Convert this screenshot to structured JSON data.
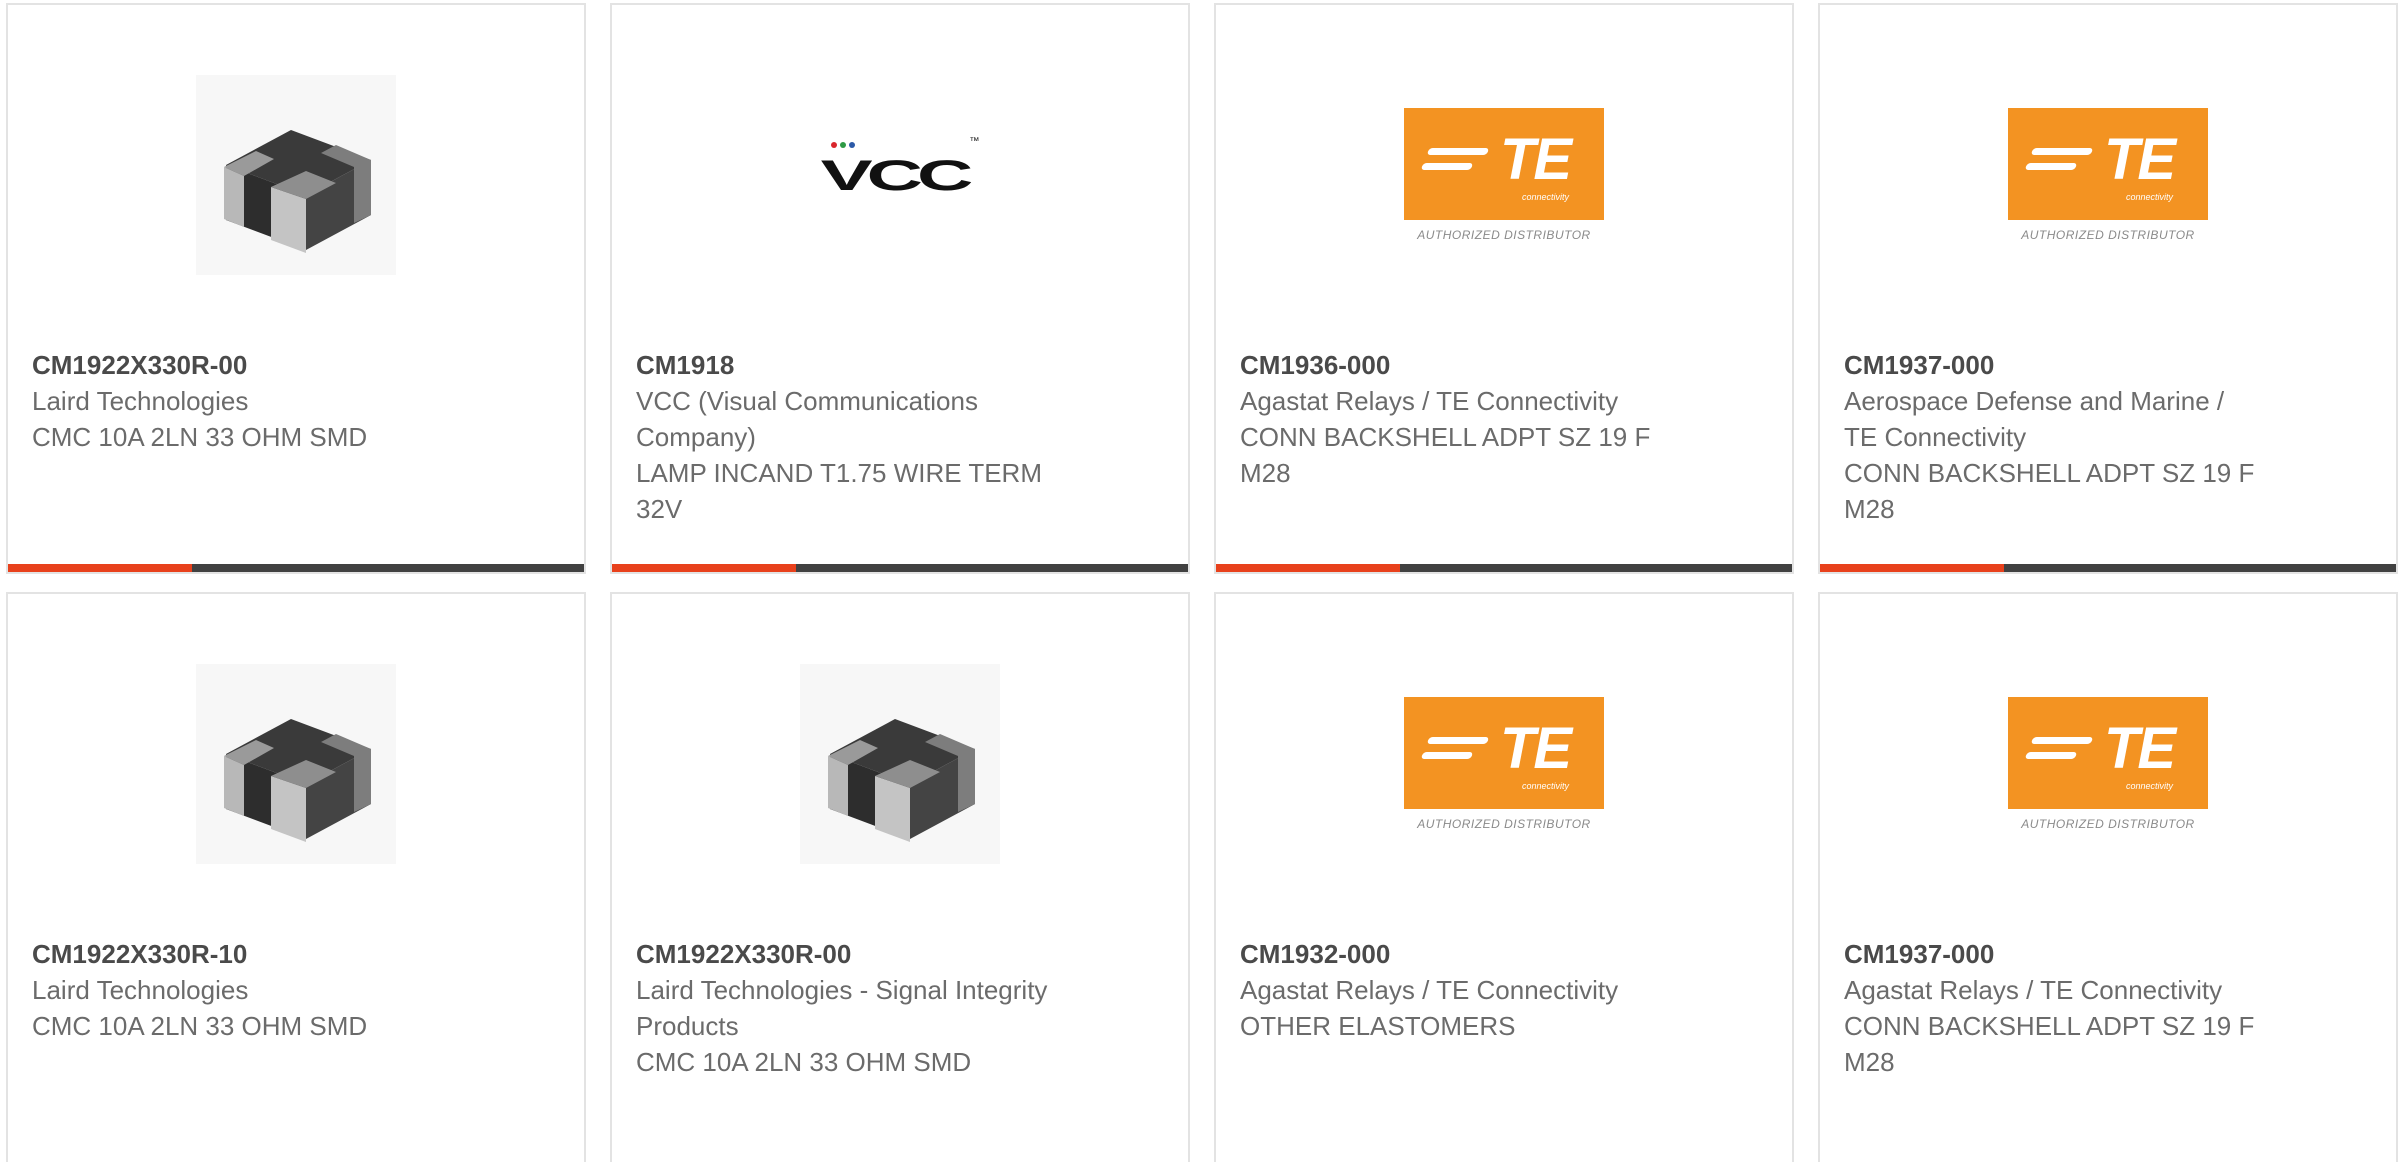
{
  "colors": {
    "accent": "#e8411c",
    "bar": "#414141",
    "te_orange": "#f39322"
  },
  "logos": {
    "vcc": {
      "text": "VCC",
      "tm": "™"
    },
    "te": {
      "text": "TE",
      "sub": "connectivity",
      "authorized": "AUTHORIZED DISTRIBUTOR"
    }
  },
  "products": [
    {
      "part_number": "CM1922X330R-00",
      "manufacturer": "Laird Technologies",
      "description": "CMC 10A 2LN 33 OHM SMD",
      "image": "inductor-chip-image"
    },
    {
      "part_number": "CM1918",
      "manufacturer": "VCC (Visual Communications Company)",
      "description": "LAMP INCAND T1.75 WIRE TERM 32V",
      "image": "vcc-logo"
    },
    {
      "part_number": "CM1936-000",
      "manufacturer": "Agastat Relays / TE Connectivity",
      "description": "CONN BACKSHELL ADPT SZ 19 F M28",
      "image": "te-logo"
    },
    {
      "part_number": "CM1937-000",
      "manufacturer": "Aerospace Defense and Marine / TE Connectivity",
      "description": "CONN BACKSHELL ADPT SZ 19 F M28",
      "image": "te-logo"
    },
    {
      "part_number": "CM1922X330R-10",
      "manufacturer": "Laird Technologies",
      "description": "CMC 10A 2LN 33 OHM SMD",
      "image": "inductor-chip-image"
    },
    {
      "part_number": "CM1922X330R-00",
      "manufacturer": "Laird Technologies - Signal Integrity Products",
      "description": "CMC 10A 2LN 33 OHM SMD",
      "image": "inductor-chip-image"
    },
    {
      "part_number": "CM1932-000",
      "manufacturer": "Agastat Relays / TE Connectivity",
      "description": "OTHER ELASTOMERS",
      "image": "te-logo"
    },
    {
      "part_number": "CM1937-000",
      "manufacturer": "Agastat Relays / TE Connectivity",
      "description": "CONN BACKSHELL ADPT SZ 19 F M28",
      "image": "te-logo"
    }
  ]
}
